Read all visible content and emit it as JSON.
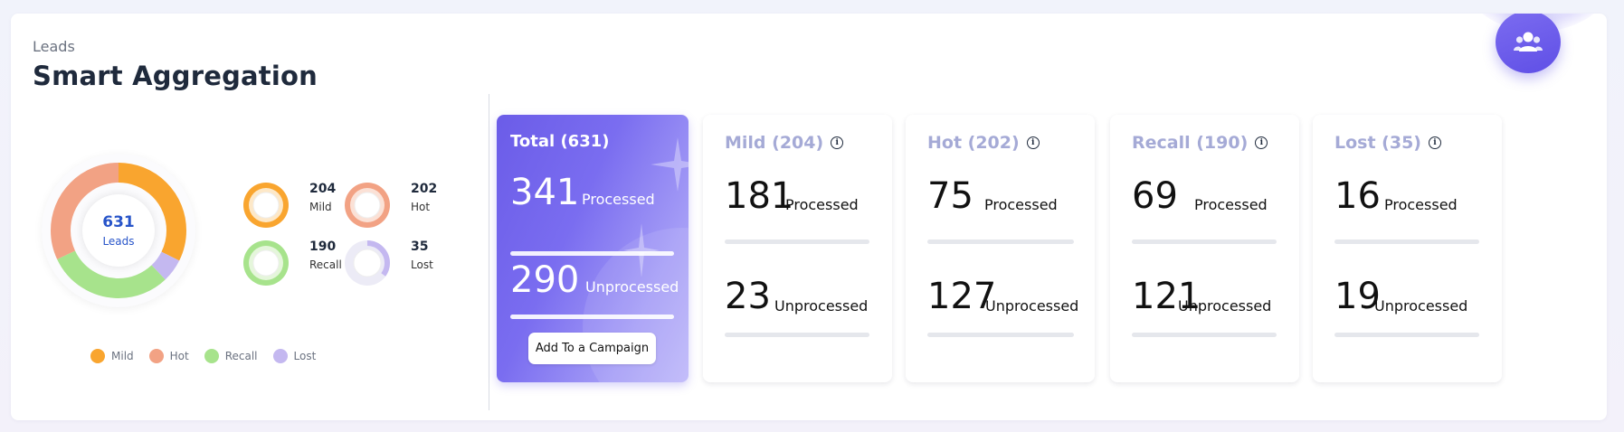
{
  "header": {
    "eyebrow": "Leads",
    "title": "Smart Aggregation"
  },
  "colors": {
    "mild": "#f9a52f",
    "hot": "#f2a284",
    "recall": "#a7e38c",
    "lost": "#c4b8f0",
    "accent": "#6b5ce8"
  },
  "donut": {
    "total": "631",
    "label": "Leads",
    "fractions": {
      "mild": 0.3233,
      "hot": 0.3201,
      "recall": 0.3011,
      "lost": 0.0555
    }
  },
  "mini_stats": [
    {
      "key": "mild",
      "value": "204",
      "label": "Mild"
    },
    {
      "key": "hot",
      "value": "202",
      "label": "Hot"
    },
    {
      "key": "recall",
      "value": "190",
      "label": "Recall"
    },
    {
      "key": "lost",
      "value": "35",
      "label": "Lost",
      "fill": 0.35
    }
  ],
  "legend": [
    {
      "key": "mild",
      "label": "Mild"
    },
    {
      "key": "hot",
      "label": "Hot"
    },
    {
      "key": "recall",
      "label": "Recall"
    },
    {
      "key": "lost",
      "label": "Lost"
    }
  ],
  "total_card": {
    "title": "Total (631)",
    "processed_value": "341",
    "processed_label": "Processed",
    "unprocessed_value": "290",
    "unprocessed_label": "Unprocessed",
    "cta_label": "Add To a Campaign"
  },
  "cards": [
    {
      "title": "Mild (204)",
      "processed_value": "181",
      "processed_label": "Processed",
      "unprocessed_value": "23",
      "unprocessed_label": "Unprocessed"
    },
    {
      "title": "Hot (202)",
      "processed_value": "75",
      "processed_label": "Processed",
      "unprocessed_value": "127",
      "unprocessed_label": "Unprocessed"
    },
    {
      "title": "Recall (190)",
      "processed_value": "69",
      "processed_label": "Processed",
      "unprocessed_value": "121",
      "unprocessed_label": "Unprocessed"
    },
    {
      "title": "Lost (35)",
      "processed_value": "16",
      "processed_label": "Processed",
      "unprocessed_value": "19",
      "unprocessed_label": "Unprocessed"
    }
  ],
  "icons": {
    "fab": "users-group-icon",
    "info": "info-icon"
  }
}
